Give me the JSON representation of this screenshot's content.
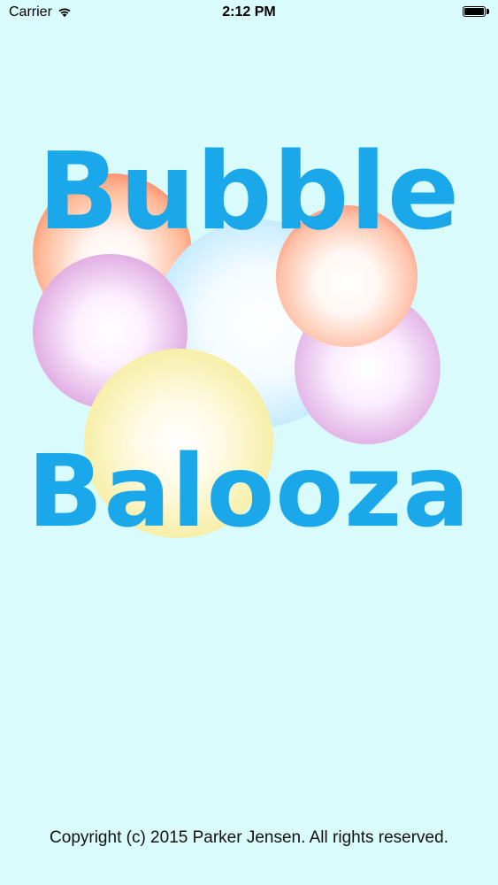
{
  "status_bar": {
    "carrier": "Carrier",
    "time": "2:12 PM",
    "wifi_icon": "wifi-icon",
    "battery_icon": "battery-icon",
    "battery_level": 1.0
  },
  "logo": {
    "line1": "Bubble",
    "line2": "Balooza",
    "text_color": "#1ba8ea",
    "bubble_colors": {
      "red": "#f05a36",
      "blue": "#8ccfef",
      "purple": "#c67bc9",
      "yellow": "#e6dc70"
    }
  },
  "footer": {
    "copyright": "Copyright (c) 2015 Parker Jensen. All rights reserved."
  },
  "theme": {
    "background": "#d9fbfc"
  }
}
